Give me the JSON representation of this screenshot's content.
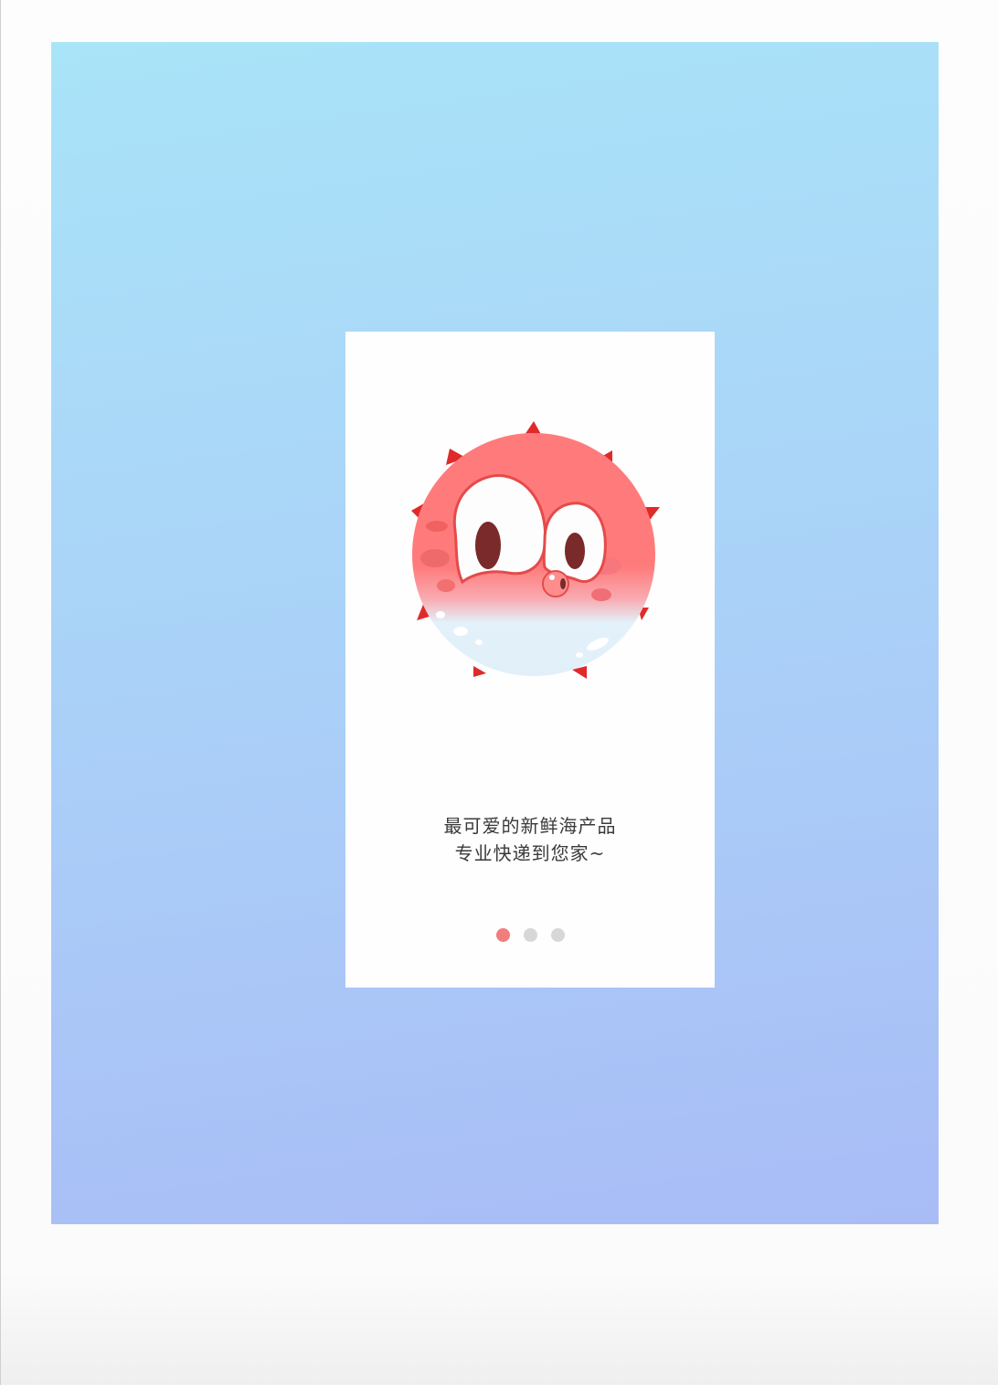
{
  "onboarding": {
    "illustration": "pufferfish-mascot",
    "slogan_line1": "最可爱的新鲜海产品",
    "slogan_line2": "专业快递到您家~",
    "pager": {
      "total": 3,
      "active_index": 0
    }
  },
  "colors": {
    "backdrop_top": "#a9e4f8",
    "backdrop_bottom": "#a9bcf6",
    "fish_body": "#ff7b7b",
    "fish_belly": "#e3f1fa",
    "spikes": "#e02a2a",
    "dot_active": "#f37c7c",
    "dot_inactive": "#d7d7d7"
  }
}
